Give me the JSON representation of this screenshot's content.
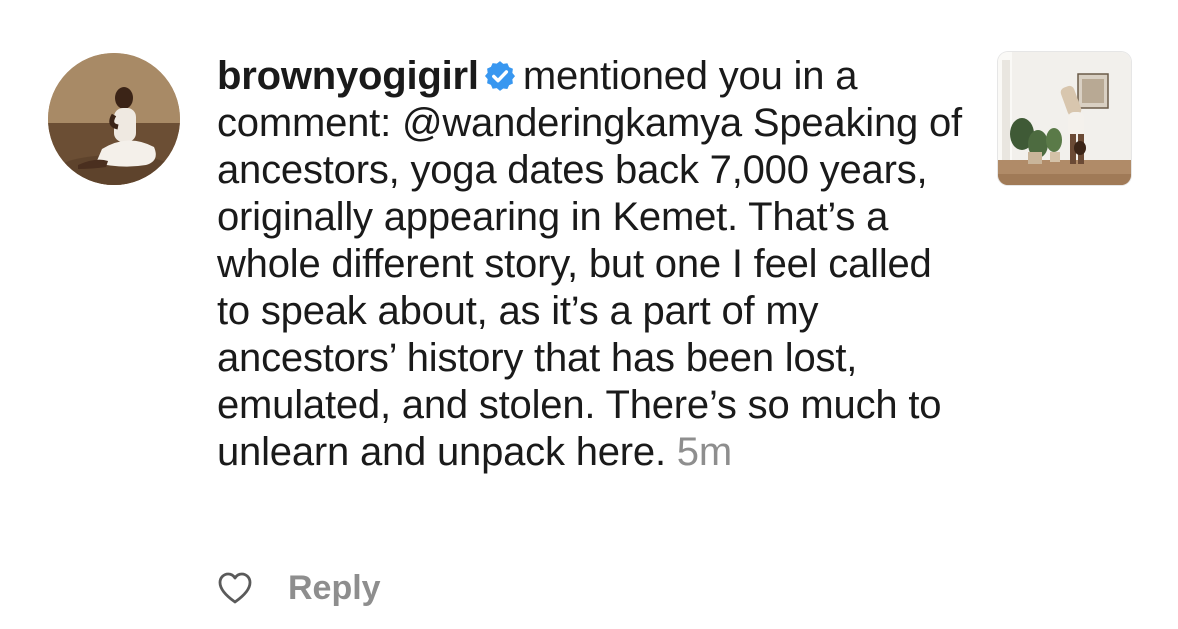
{
  "notification": {
    "username": "brownyogigirl",
    "action_text": "mentioned you in a comment:",
    "mention": "@wanderingkamya",
    "body": "Speaking of ancestors, yoga dates back 7,000 years, originally appearing in Kemet. That’s a whole different story, but one I feel called to speak about, as it’s a part of my ancestors’ history that has been lost, emulated, and stolen. There’s so much to unlearn and unpack here.",
    "time": "5m"
  },
  "actions": {
    "reply_label": "Reply"
  },
  "icons": {
    "verified": "verified-badge-icon",
    "like": "heart-outline-icon"
  },
  "colors": {
    "verified_blue": "#3897f0",
    "text": "#1a1a1a",
    "muted": "#8e8e8e"
  }
}
